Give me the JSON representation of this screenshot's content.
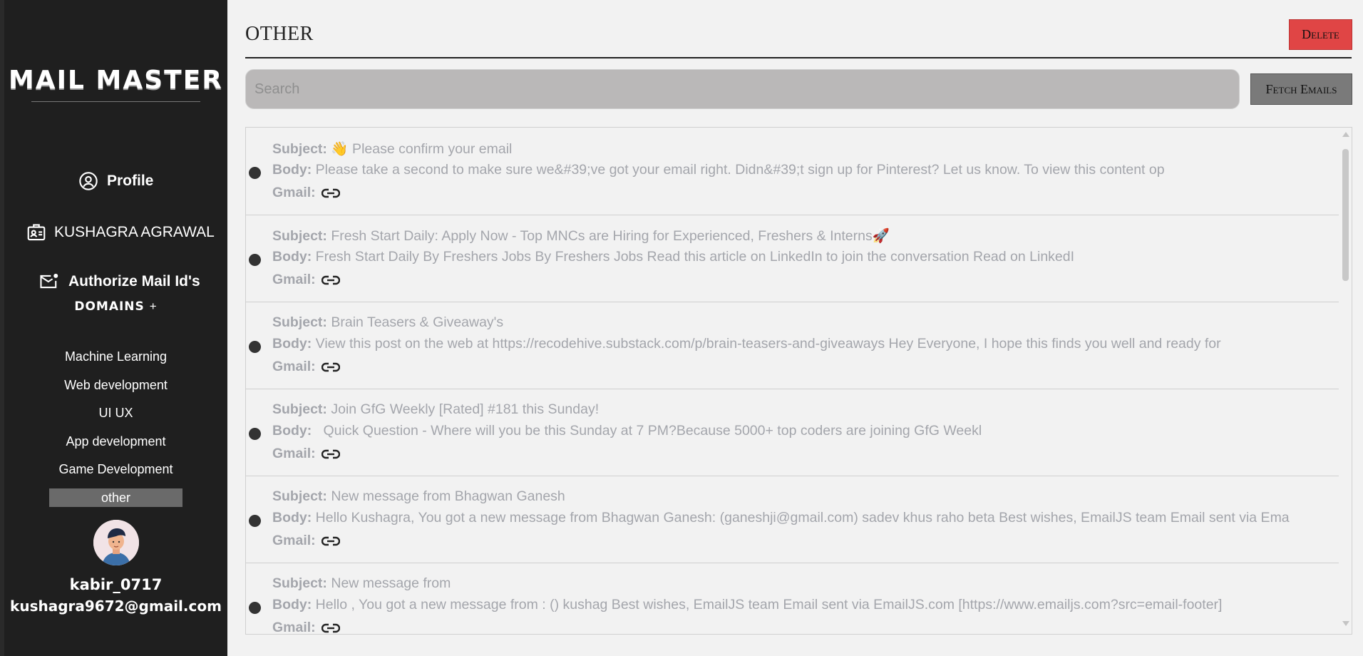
{
  "sidebar": {
    "logo": "MAIL MASTER",
    "profile_label": "Profile",
    "user_name_label": "KUSHAGRA AGRAWAL",
    "authorize_label": "Authorize Mail Id's",
    "domains_title": "DOMAINS",
    "domains_add": "+",
    "domains": [
      "Machine Learning",
      "Web development",
      "UI UX",
      "App development",
      "Game Development",
      "other"
    ],
    "active_domain": "other",
    "username": "kabir_0717",
    "email": "kushagra9672@gmail.com"
  },
  "main": {
    "title": "OTHER",
    "delete_label": "Delete",
    "search_placeholder": "Search",
    "fetch_label": "Fetch Emails",
    "subject_label": "Subject:",
    "body_label": "Body:",
    "gmail_label": "Gmail:",
    "emails": [
      {
        "subject": "👋 Please confirm your email",
        "body": "Please take a second to make sure we&#39;ve got your email right. Didn&#39;t sign up for Pinterest? Let us know. To view this content op"
      },
      {
        "subject": "Fresh Start Daily: Apply Now - Top MNCs are Hiring for Experienced, Freshers & Interns🚀",
        "body": "Fresh Start Daily By Freshers Jobs By Freshers Jobs Read this article on LinkedIn to join the conversation Read on LinkedI"
      },
      {
        "subject": "Brain Teasers & Giveaway's",
        "body": "View this post on the web at https://recodehive.substack.com/p/brain-teasers-and-giveaways Hey Everyone, I hope this finds you well and ready for"
      },
      {
        "subject": "Join GfG Weekly [Rated] #181 this Sunday!",
        "body": "  Quick Question - Where will you be this Sunday at 7 PM?Because 5000+ top coders are joining GfG Weekl"
      },
      {
        "subject": "New message from Bhagwan Ganesh",
        "body": "Hello Kushagra, You got a new message from Bhagwan Ganesh: (ganeshji@gmail.com) sadev khus raho beta Best wishes, EmailJS team Email sent via Ema"
      },
      {
        "subject": "New message from",
        "body": "Hello , You got a new message from : () kushag Best wishes, EmailJS team Email sent via EmailJS.com [https://www.emailjs.com?src=email-footer]"
      }
    ]
  },
  "colors": {
    "sidebar_bg": "#1f1f1f",
    "delete_bg": "#e04545",
    "fetch_bg": "#7a7a7a",
    "search_bg": "#bab8b8",
    "email_text": "#a4a6ac",
    "active_domain_bg": "#6a6a6a"
  }
}
